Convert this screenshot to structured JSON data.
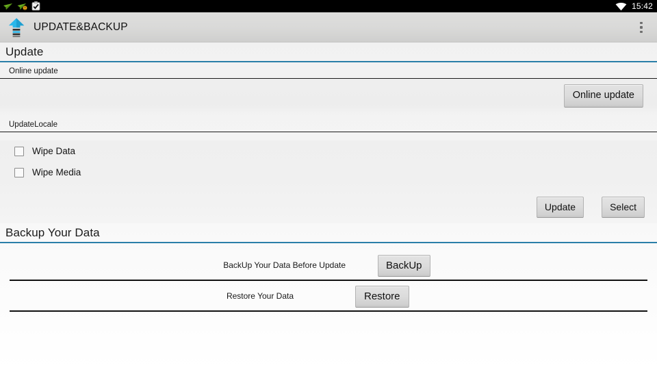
{
  "status_bar": {
    "icons": [
      "paper-plane-icon",
      "paper-plane-alert-icon",
      "clipboard-check-icon"
    ],
    "wifi_icon": "wifi-icon",
    "clock": "15:42",
    "background": "#000000",
    "text_color": "#ffffff"
  },
  "app_bar": {
    "icon": "update-upload-icon",
    "title": "UPDATE&BACKUP",
    "overflow_icon": "overflow-menu-icon",
    "background": "#d9d9d8"
  },
  "theme": {
    "accent": "#2a7fa8",
    "divider": "#111111",
    "button_face": "#dcdcdc",
    "icon_cyan": "#29b6e8",
    "icon_blue": "#1b8fc4"
  },
  "update_section": {
    "header": "Update",
    "online": {
      "label": "Online update",
      "button": "Online update"
    },
    "locale": {
      "label": "UpdateLocale",
      "checkboxes": [
        {
          "label": "Wipe Data",
          "checked": false
        },
        {
          "label": "Wipe Media",
          "checked": false
        }
      ],
      "buttons": [
        {
          "label": "Update"
        },
        {
          "label": "Select"
        }
      ]
    }
  },
  "backup_section": {
    "header": "Backup Your Data",
    "rows": [
      {
        "label": "BackUp Your Data Before Update",
        "button": "BackUp"
      },
      {
        "label": "Restore Your Data",
        "button": "Restore"
      }
    ]
  }
}
